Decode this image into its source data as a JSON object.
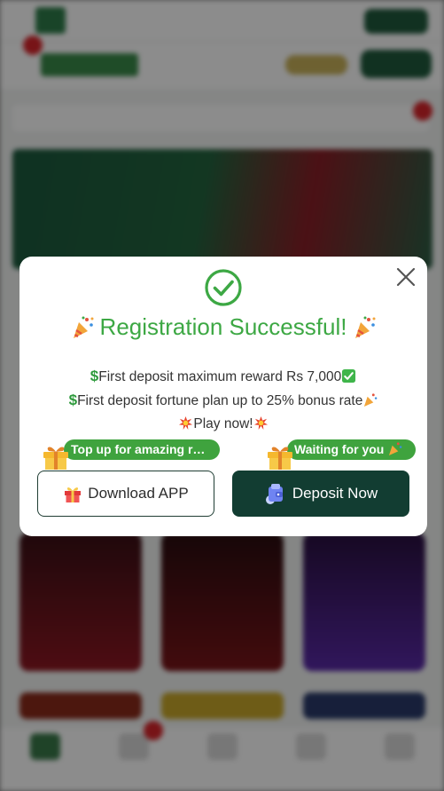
{
  "modal": {
    "title": "Registration Successful!",
    "line1": "First deposit maximum reward Rs 7,000",
    "line2": "First deposit fortune plan up to 25% bonus rate",
    "line3": "Play now!",
    "tag_left": "Top up for amazing r…",
    "tag_right": "Waiting for you",
    "download_label": "Download APP",
    "deposit_label": "Deposit Now"
  },
  "colors": {
    "success_green": "#3da844",
    "tag_green": "#3fa33e",
    "deposit_button": "#123d32",
    "overlay": "rgba(0,0,0,0.45)"
  },
  "icons": [
    "check-circle-icon",
    "party-popper-icon",
    "dollar-icon",
    "checkmark-box-icon",
    "collision-icon",
    "gift-icon",
    "wallet-icon",
    "close-icon"
  ]
}
